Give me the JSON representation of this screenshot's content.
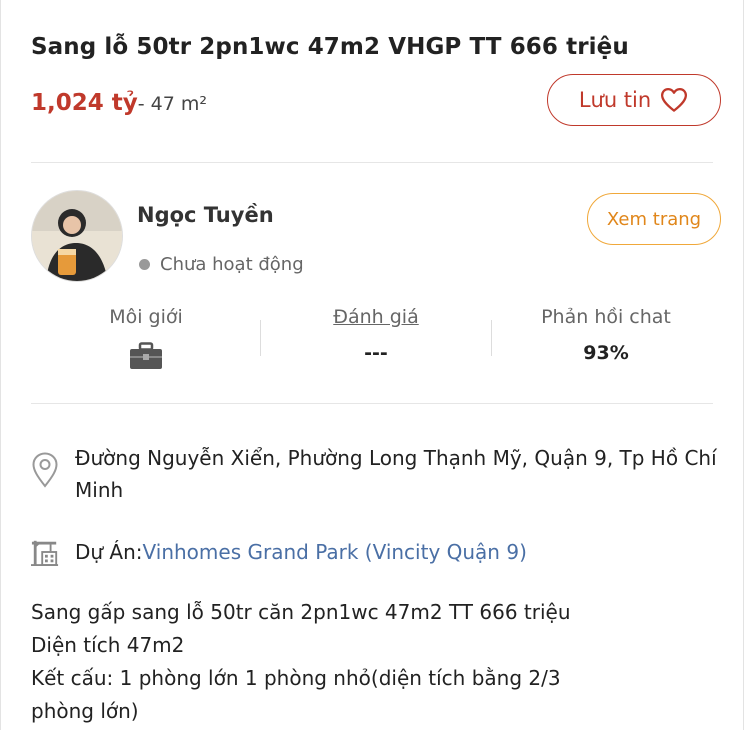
{
  "listing": {
    "title": "Sang lỗ 50tr 2pn1wc 47m2 VHGP TT 666 triệu",
    "price": "1,024 tỷ",
    "area": "- 47 m²",
    "save_label": "Lưu tin"
  },
  "seller": {
    "name": "Ngọc Tuyền",
    "status": "Chưa hoạt động",
    "view_label": "Xem trang",
    "stats": {
      "type_label": "Môi giới",
      "rating_label": "Đánh giá",
      "rating_value": "---",
      "reply_label": "Phản hồi chat",
      "reply_value": "93%"
    }
  },
  "location": {
    "address": "Đường Nguyễn Xiển, Phường Long Thạnh Mỹ, Quận 9, Tp Hồ Chí Minh",
    "project_label": "Dự Án: ",
    "project_name": "Vinhomes Grand Park (Vincity Quận 9)"
  },
  "description": {
    "lines": [
      "Sang gấp sang lỗ 50tr căn 2pn1wc 47m2 TT 666 triệu",
      "Diện tích 47m2",
      "Kết cấu: 1 phòng lớn 1 phòng nhỏ(diện tích bằng 2/3",
      "phòng lớn)"
    ]
  },
  "colors": {
    "price": "#c0392b",
    "accent_orange": "#f0a83a",
    "link": "#4a6fa5"
  },
  "icons": [
    "heart-icon",
    "briefcase-icon",
    "location-pin-icon",
    "building-crane-icon"
  ]
}
